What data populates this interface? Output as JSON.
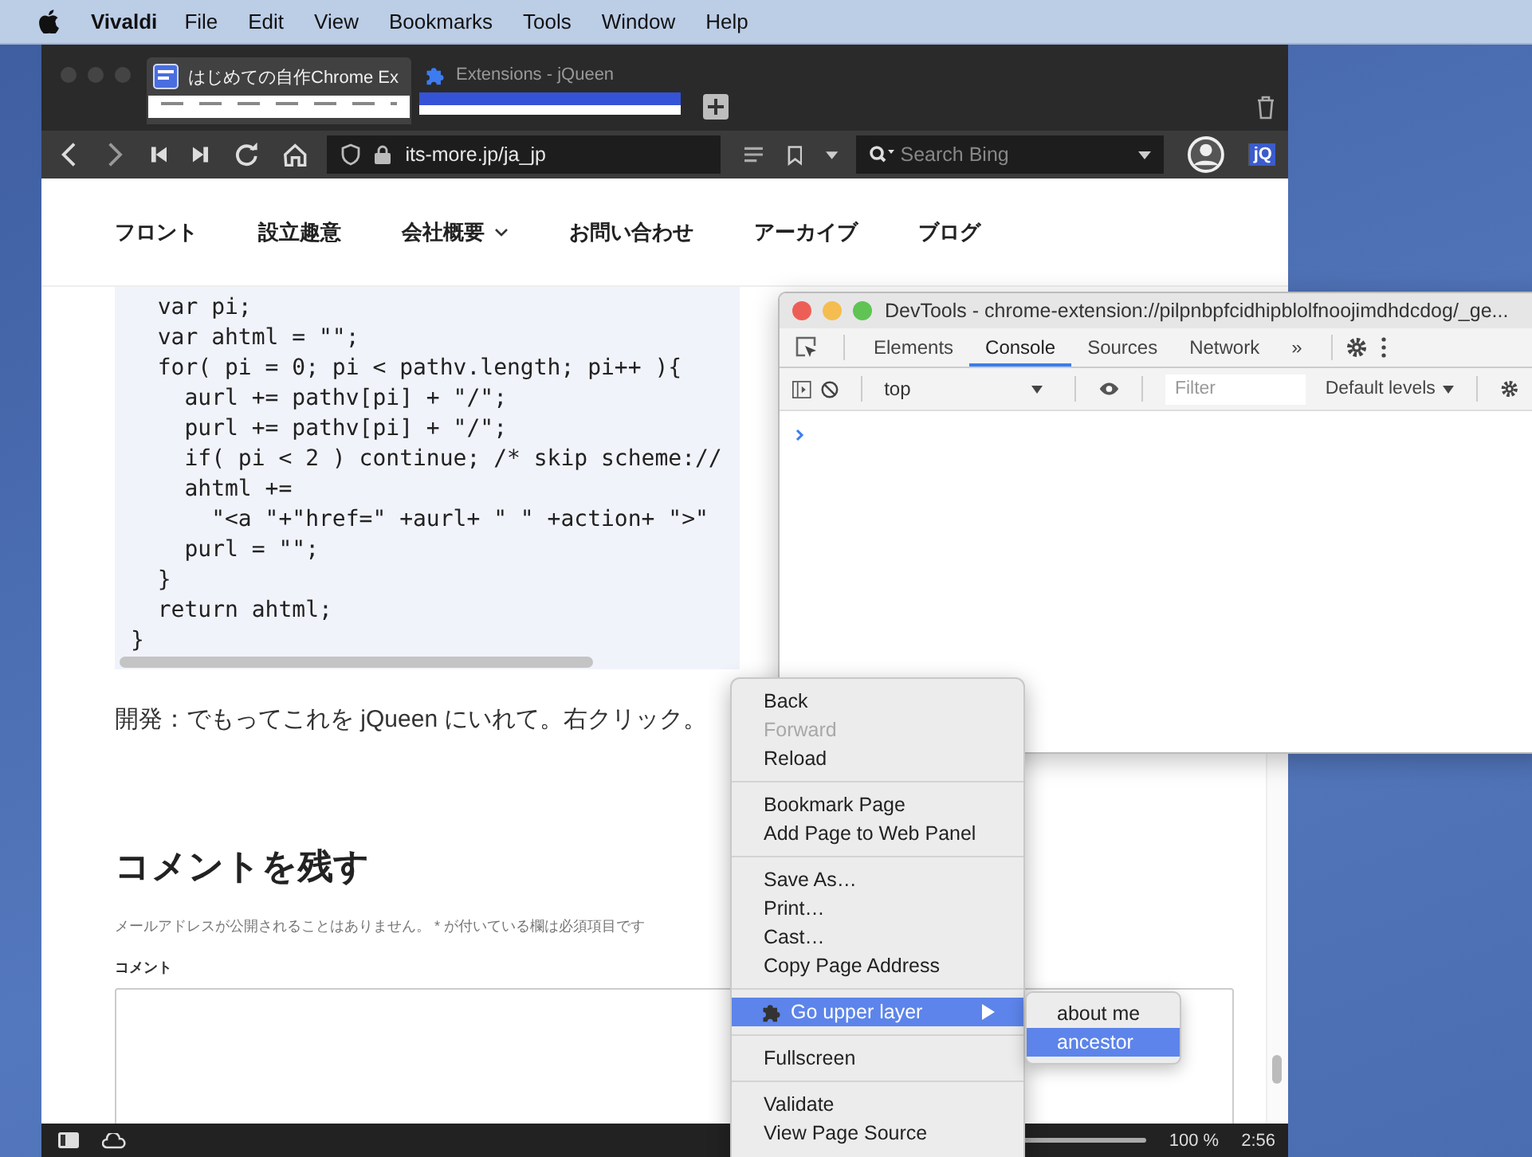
{
  "menu_bar": {
    "app": "Vivaldi",
    "items": [
      "File",
      "Edit",
      "View",
      "Bookmarks",
      "Tools",
      "Window",
      "Help"
    ]
  },
  "browser": {
    "tabs": [
      {
        "title": "はじめての自作Chrome Ex",
        "selected": true
      },
      {
        "title": "Extensions - jQueen",
        "selected": false
      }
    ],
    "address": "its-more.jp/ja_jp",
    "search": {
      "placeholder": "Search Bing"
    },
    "extension_badge": "jQ",
    "page": {
      "nav": [
        {
          "label": "フロント",
          "submenu": false
        },
        {
          "label": "設立趣意",
          "submenu": false
        },
        {
          "label": "会社概要",
          "submenu": true
        },
        {
          "label": "お問い合わせ",
          "submenu": false
        },
        {
          "label": "アーカイブ",
          "submenu": false
        },
        {
          "label": "ブログ",
          "submenu": false
        }
      ],
      "code_lines": [
        "  var pi;",
        "  var ahtml = \"\";",
        "  for( pi = 0; pi < pathv.length; pi++ ){",
        "    aurl += pathv[pi] + \"/\";",
        "    purl += pathv[pi] + \"/\";",
        "    if( pi < 2 ) continue; /* skip scheme://",
        "    ahtml +=",
        "      \"<a \"+\"href=\" +aurl+ \" \" +action+ \">\"",
        "    purl = \"\";",
        "  }",
        "  return ahtml;",
        "}"
      ],
      "paragraph": "開発：でもってこれを jQueen にいれて。右クリック。",
      "comments": {
        "heading": "コメントを残す",
        "note": "メールアドレスが公開されることはありません。 * が付いている欄は必須項目です",
        "label": "コメント"
      }
    },
    "status_bar": {
      "zoom": "100 %",
      "time": "2:56"
    }
  },
  "devtools": {
    "title": "DevTools - chrome-extension://pilpnbpfcidhipblolfnoojimdhdcdog/_ge...",
    "tabs": [
      {
        "label": "Elements",
        "selected": false
      },
      {
        "label": "Console",
        "selected": true
      },
      {
        "label": "Sources",
        "selected": false
      },
      {
        "label": "Network",
        "selected": false
      },
      {
        "label": "»",
        "selected": false
      }
    ],
    "context": "top",
    "filter": {
      "placeholder": "Filter"
    },
    "levels": "Default levels"
  },
  "context_menu": {
    "groups": [
      [
        {
          "label": "Back",
          "disabled": false,
          "selected": false,
          "submenu": false
        },
        {
          "label": "Forward",
          "disabled": true,
          "selected": false,
          "submenu": false
        },
        {
          "label": "Reload",
          "disabled": false,
          "selected": false,
          "submenu": false
        }
      ],
      [
        {
          "label": "Bookmark Page",
          "disabled": false,
          "selected": false,
          "submenu": false
        },
        {
          "label": "Add Page to Web Panel",
          "disabled": false,
          "selected": false,
          "submenu": false
        }
      ],
      [
        {
          "label": "Save As…",
          "disabled": false,
          "selected": false,
          "submenu": false
        },
        {
          "label": "Print…",
          "disabled": false,
          "selected": false,
          "submenu": false
        },
        {
          "label": "Cast…",
          "disabled": false,
          "selected": false,
          "submenu": false
        },
        {
          "label": "Copy Page Address",
          "disabled": false,
          "selected": false,
          "submenu": false
        }
      ],
      [
        {
          "label": "Go upper layer",
          "disabled": false,
          "selected": true,
          "submenu": true
        }
      ],
      [
        {
          "label": "Fullscreen",
          "disabled": false,
          "selected": false,
          "submenu": false
        }
      ],
      [
        {
          "label": "Validate",
          "disabled": false,
          "selected": false,
          "submenu": false
        },
        {
          "label": "View Page Source",
          "disabled": false,
          "selected": false,
          "submenu": false
        }
      ]
    ],
    "submenu": [
      {
        "label": "about me",
        "selected": false
      },
      {
        "label": "ancestor",
        "selected": true
      }
    ]
  }
}
